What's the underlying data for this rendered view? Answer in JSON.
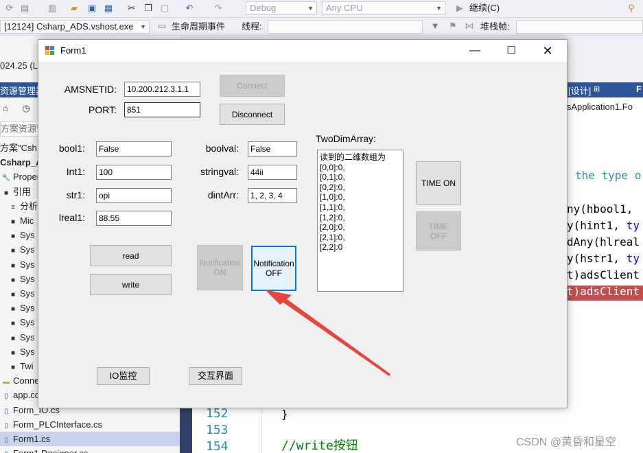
{
  "vs": {
    "toolbar": {
      "config_combo": "Debug",
      "platform_combo": "Any CPU",
      "continue_label": "继续(C)",
      "process_combo": "[12124] Csharp_ADS.vshost.exe",
      "lifecycle_label": "生命周期事件",
      "thread_label": "线程:",
      "stackframe_label": "堆栈帧:"
    },
    "left_panel": {
      "version_text": "024.25 (L",
      "header_title": "资源管理器",
      "search_placeholder": "方案资源管",
      "tree": [
        {
          "label": "方案\"Csh",
          "icon": ""
        },
        {
          "label": "Csharp_A",
          "icon": ""
        },
        {
          "label": "Proper",
          "icon": "wrench"
        },
        {
          "label": "引用",
          "icon": "ref"
        },
        {
          "label": "分析",
          "icon": "analyzer"
        },
        {
          "label": "Mic",
          "icon": "ref"
        },
        {
          "label": "Sys",
          "icon": "ref"
        },
        {
          "label": "Sys",
          "icon": "ref"
        },
        {
          "label": "Sys",
          "icon": "ref"
        },
        {
          "label": "Sys",
          "icon": "ref"
        },
        {
          "label": "Sys",
          "icon": "ref"
        },
        {
          "label": "Sys",
          "icon": "ref"
        },
        {
          "label": "Sys",
          "icon": "ref"
        },
        {
          "label": "Sys",
          "icon": "ref"
        },
        {
          "label": "Sys",
          "icon": "ref"
        },
        {
          "label": "Twi",
          "icon": "ref"
        },
        {
          "label": "Conne",
          "icon": "folder"
        },
        {
          "label": "app.co",
          "icon": "file"
        },
        {
          "label": "Form_IO.cs",
          "icon": "file"
        },
        {
          "label": "Form_PLCInterface.cs",
          "icon": "file"
        },
        {
          "label": "Form1.cs",
          "icon": "file"
        },
        {
          "label": "Form1.Designer.cs",
          "icon": "file"
        }
      ]
    },
    "right_header": "[设计]",
    "editor": {
      "tab_fragment": "msApplication1.Fo",
      "comment_fragment": "the type o",
      "lines": [
        {
          "kind": "plain",
          "pre": "ny(hbool1,",
          "post": ""
        },
        {
          "kind": "typed",
          "pre": "y(hint1, ",
          "post": "ty"
        },
        {
          "kind": "plain",
          "pre": "dAny(hlreal",
          "post": ""
        },
        {
          "kind": "typed",
          "pre": "y(hstr1, ",
          "post": "ty"
        },
        {
          "kind": "plain",
          "pre": "t)adsClient",
          "post": ""
        },
        {
          "kind": "plain",
          "pre": "t)adsClient",
          "post": ""
        }
      ],
      "line_152": "152",
      "line_153": "153",
      "line_154": "154",
      "brace": "}",
      "write_comment": "//write按钮"
    },
    "watermark": "CSDN @黄昏和星空"
  },
  "form": {
    "title": "Form1",
    "amsnetid_label": "AMSNETID:",
    "amsnetid_value": "10.200.212.3.1.1",
    "port_label": "PORT:",
    "port_value": "851",
    "connect_label": "Connect",
    "disconnect_label": "Disconnect",
    "bool1_label": "bool1:",
    "bool1_value": "False",
    "int1_label": "Int1:",
    "int1_value": "100",
    "str1_label": "str1:",
    "str1_value": "opi",
    "lreal1_label": "lreal1:",
    "lreal1_value": "88.55",
    "boolval_label": "boolval:",
    "boolval_value": "False",
    "stringval_label": "stringval:",
    "stringval_value": "44ii",
    "dintarr_label": "dintArr:",
    "dintarr_value": "1, 2, 3, 4",
    "read_label": "read",
    "write_label": "write",
    "notif_on_label": "Notification ON",
    "notif_off_label": "Notification OFF",
    "twodim_label": "TwoDimArray:",
    "listbox_items": [
      "读到的二维数组为",
      "[0,0]:0,",
      "[0,1]:0,",
      "[0,2]:0,",
      "[1,0]:0,",
      "[1,1]:0,",
      "[1,2]:0,",
      "[2,0]:0,",
      "[2,1]:0,",
      "[2,2]:0"
    ],
    "time_on_label": "TIME ON",
    "time_off_label": "TIME OFF",
    "io_monitor_label": "IO监控",
    "interaction_label": "交互界面"
  },
  "colors": {
    "annotation_arrow": "#e8453c",
    "focus_border": "#0078d7",
    "vs_accent": "#2f5597"
  }
}
